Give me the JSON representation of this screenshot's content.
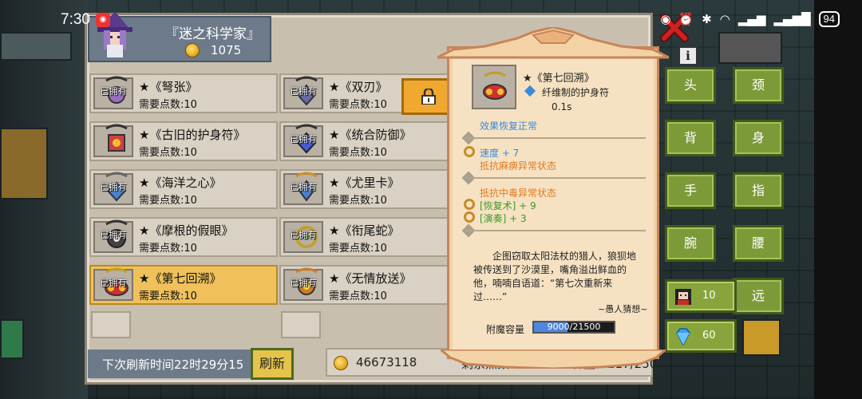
{
  "status_bar": {
    "time": "7:30",
    "battery": "94"
  },
  "header": {
    "title": "『迷之科学家』",
    "coins": "1075"
  },
  "items": [
    {
      "owned": "已拥有",
      "name": "★《弩张》",
      "cost": "需要点数:10",
      "color": "#9a6fbf"
    },
    {
      "owned": "已拥有",
      "name": "★《双刃》",
      "cost": "需要点数:10",
      "color": "#6a6aa8"
    },
    {
      "owned": "",
      "name": "★《古旧的护身符》",
      "cost": "需要点数:10",
      "color": "#d04040"
    },
    {
      "owned": "已拥有",
      "name": "★《统合防御》",
      "cost": "需要点数:10",
      "color": "#4a5ad0"
    },
    {
      "owned": "已拥有",
      "name": "★《海洋之心》",
      "cost": "需要点数:10",
      "color": "#4a80d0"
    },
    {
      "owned": "已拥有",
      "name": "★《尤里卡》",
      "cost": "需要点数:10",
      "color": "#d0902a"
    },
    {
      "owned": "已拥有",
      "name": "★《摩根的假眼》",
      "cost": "需要点数:10",
      "color": "#444444"
    },
    {
      "owned": "已拥有",
      "name": "★《衔尾蛇》",
      "cost": "需要点数:10",
      "color": "#c0a030"
    },
    {
      "owned": "已拥有",
      "name": "★《第七回溯》",
      "cost": "需要点数:10",
      "color": "#d03030",
      "selected": true
    },
    {
      "owned": "已拥有",
      "name": "★《无情放送》",
      "cost": "需要点数:10",
      "color": "#d07a2a"
    }
  ],
  "bottom": {
    "refresh_time": "下次刷新时间22时29分15",
    "refresh_button": "刷新",
    "gold": "46673118",
    "remaining": "剩余点数:10",
    "capacity": "容量：217/250"
  },
  "detail": {
    "name": "★《第七回溯》",
    "subtitle": "纤维制的护身符",
    "time": "0.1s",
    "effect1": "效果恢复正常",
    "effect2a": "速度 + 7",
    "effect2b": "抵抗麻痹异常状态",
    "effect3a": "抵抗中毒异常状态",
    "effect3b": "[恢复术] + 9",
    "effect3c": "[演奏] + 3",
    "description": "企图窃取太阳法杖的猎人，狼狈地被传送到了沙漠里，嘴角溢出鲜血的他，喃喃自语道：“第七次重新来过……”",
    "author": "~愚人猜想~",
    "capacity_label": "附魔容量",
    "capacity_value": "9000/21500",
    "capacity_fraction": 0.4186
  },
  "slots": {
    "head": "头",
    "neck": "颈",
    "back": "背",
    "body": "身",
    "hand": "手",
    "finger": "指",
    "wrist": "腕",
    "waist": "腰",
    "far": "远"
  },
  "currency": {
    "tickets": "10",
    "gems": "60"
  },
  "info_label": "i"
}
